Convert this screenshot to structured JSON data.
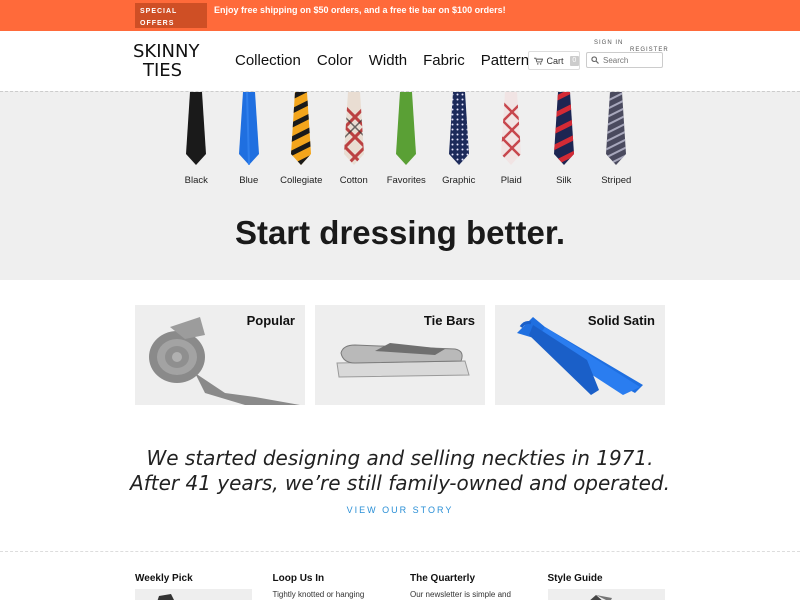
{
  "promo": {
    "badge": "SPECIAL OFFERS",
    "text": "Enjoy free shipping on $50 orders, and a free tie bar on $100 orders!"
  },
  "header": {
    "logo_top": "SKINNY",
    "logo_bottom": "TIES",
    "nav": [
      "Collection",
      "Color",
      "Width",
      "Fabric",
      "Pattern"
    ],
    "cart_label": "Cart",
    "cart_count": "0",
    "sign_in": "SIGN In",
    "register": "REGISTER",
    "search_placeholder": "Search"
  },
  "hero": {
    "ties": [
      {
        "label": "Black",
        "icon": "tie-black-icon"
      },
      {
        "label": "Blue",
        "icon": "tie-blue-icon"
      },
      {
        "label": "Collegiate",
        "icon": "tie-collegiate-icon"
      },
      {
        "label": "Cotton",
        "icon": "tie-cotton-icon"
      },
      {
        "label": "Favorites",
        "icon": "tie-favorites-icon"
      },
      {
        "label": "Graphic",
        "icon": "tie-graphic-icon"
      },
      {
        "label": "Plaid",
        "icon": "tie-plaid-icon"
      },
      {
        "label": "Silk",
        "icon": "tie-silk-icon"
      },
      {
        "label": "Striped",
        "icon": "tie-striped-icon"
      }
    ],
    "title": "Start dressing better."
  },
  "tiles": [
    {
      "label": "Popular"
    },
    {
      "label": "Tie Bars"
    },
    {
      "label": "Solid Satin"
    }
  ],
  "story": {
    "line1": "We started designing and selling neckties in 1971.",
    "line2": "After 41 years, we’re still family-owned and operated.",
    "link": "VIEW OUR STORY"
  },
  "footer_cols": [
    {
      "title": "Weekly Pick",
      "text": ""
    },
    {
      "title": "Loop Us In",
      "text": "Tightly knotted or hanging"
    },
    {
      "title": "The Quarterly",
      "text": "Our newsletter is simple and"
    },
    {
      "title": "Style Guide",
      "text": ""
    }
  ],
  "colors": {
    "promo_bg": "#ff6a3a",
    "promo_badge": "#cf4f25",
    "link": "#2a8fd6",
    "hero_bg": "#efefef"
  }
}
